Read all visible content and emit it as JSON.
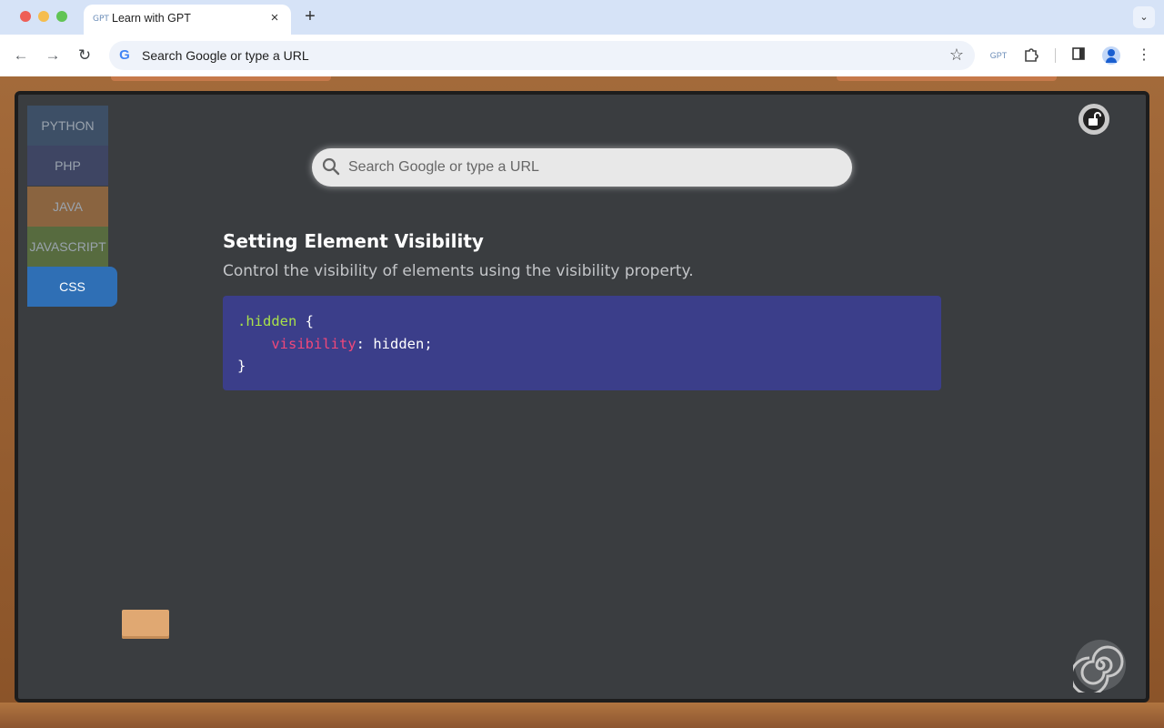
{
  "browser": {
    "tab_title": "Learn with GPT",
    "tab_favicon": "GPT",
    "tab_close": "×",
    "new_tab": "+",
    "omnibox_text": "Search Google or type a URL",
    "extension_label": "GPT"
  },
  "sidebar": {
    "items": [
      {
        "label": "PYTHON",
        "color": "#3d4f66"
      },
      {
        "label": "PHP",
        "color": "#3e4563"
      },
      {
        "label": "JAVA",
        "color": "#8a6440"
      },
      {
        "label": "JAVASCRIPT",
        "color": "#576b3f"
      },
      {
        "label": "CSS",
        "color": "#2f6fb5",
        "active": true
      }
    ]
  },
  "search": {
    "placeholder": "Search Google or type a URL"
  },
  "lesson": {
    "title": "Setting Element Visibility",
    "description": "Control the visibility of elements using the visibility property.",
    "code": {
      "selector": ".hidden",
      "open_brace": " {",
      "property": "visibility",
      "separator": ": ",
      "value": "hidden;",
      "close_brace": "}"
    }
  },
  "colors": {
    "board": "#3a3d40",
    "frame": "#a36a3a",
    "code_background": "#3b3e8a",
    "selector": "#a8e04a",
    "property": "#f0487a"
  },
  "icons": [
    "lock-icon",
    "search-icon",
    "spiral-logo-icon",
    "star-icon",
    "extensions-puzzle-icon",
    "side-panel-icon",
    "profile-icon",
    "menu-kebab-icon"
  ]
}
